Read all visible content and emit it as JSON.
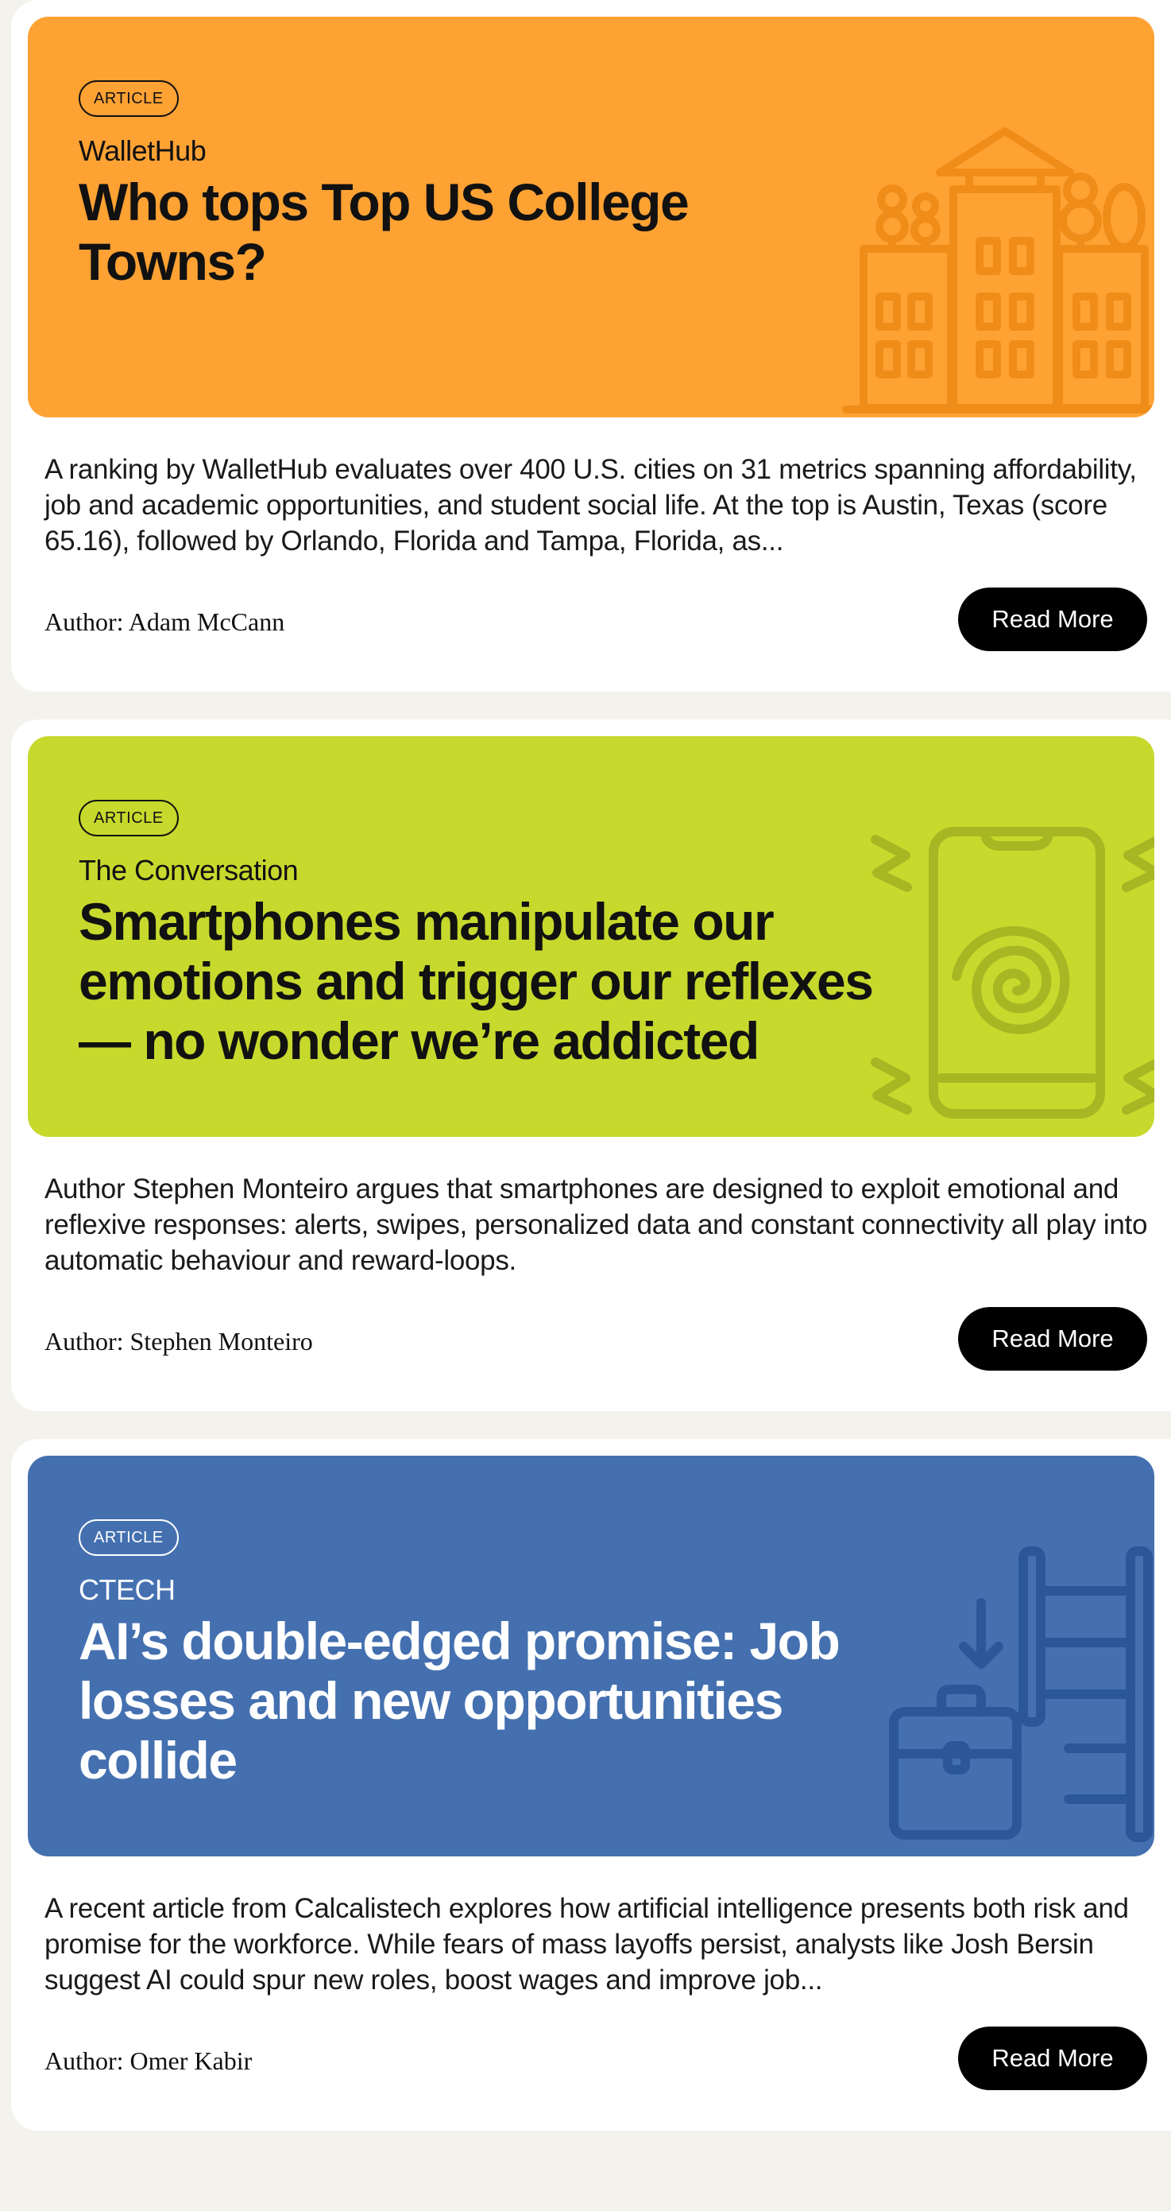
{
  "articles": [
    {
      "badge": "ARTICLE",
      "source": "WalletHub",
      "title": "Who tops Top US College Towns?",
      "description": "A ranking by WalletHub evaluates over 400 U.S. cities on 31 metrics spanning affordability, job and academic opportunities, and student social life. At the top is Austin, Texas (score 65.16), followed by Orlando, Florida and Tampa, Florida, as...",
      "author": "Author: Adam McCann",
      "button": "Read More",
      "hero_color": "#ffa234",
      "icon": "college-buildings-icon"
    },
    {
      "badge": "ARTICLE",
      "source": "The Conversation",
      "title": "Smartphones manipulate our emotions and trigger our reflexes — no wonder we’re addicted",
      "description": "Author Stephen Monteiro argues that smartphones are designed to exploit emotional and reflexive responses: alerts, swipes, personalized data and constant connectivity all play into automatic behaviour and reward-loops.",
      "author": "Author: Stephen Monteiro",
      "button": "Read More",
      "hero_color": "#c7d92d",
      "icon": "hypnotic-smartphone-icon"
    },
    {
      "badge": "ARTICLE",
      "source": "CTECH",
      "title": "AI’s double-edged promise: Job losses and new opportunities collide",
      "description": "A recent article from Calcalistech explores how artificial intelligence presents both risk and promise for the workforce. While fears of mass layoffs persist, analysts like Josh Bersin suggest AI could spur new roles, boost wages and improve job...",
      "author": "Author: Omer Kabir",
      "button": "Read More",
      "hero_color": "#4470b0",
      "icon": "briefcase-ladder-icon"
    }
  ]
}
